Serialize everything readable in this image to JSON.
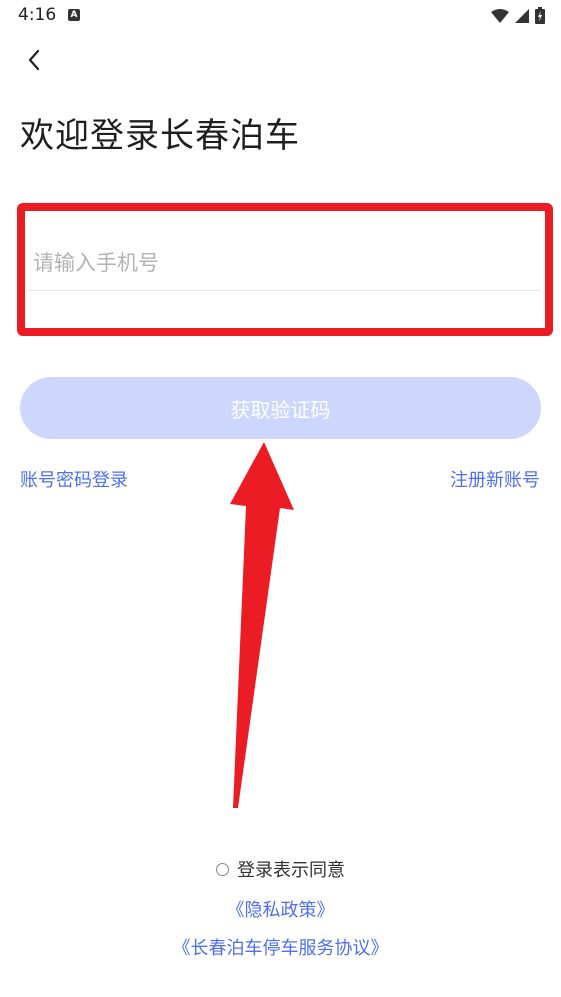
{
  "status_bar": {
    "time": "4:16",
    "notification_icon": "A"
  },
  "header": {
    "back_icon": "chevron-left-icon"
  },
  "page": {
    "title": "欢迎登录长春泊车"
  },
  "phone_input": {
    "placeholder": "请输入手机号",
    "value": ""
  },
  "buttons": {
    "get_code": "获取验证码"
  },
  "links": {
    "password_login": "账号密码登录",
    "register": "注册新账号"
  },
  "agreement": {
    "text": "登录表示同意",
    "privacy_policy": "《隐私政策》",
    "service_agreement": "《长春泊车停车服务协议》"
  },
  "colors": {
    "accent": "#4f6ff2",
    "button_disabled": "#cdd6fd",
    "highlight": "#ec1c24"
  }
}
